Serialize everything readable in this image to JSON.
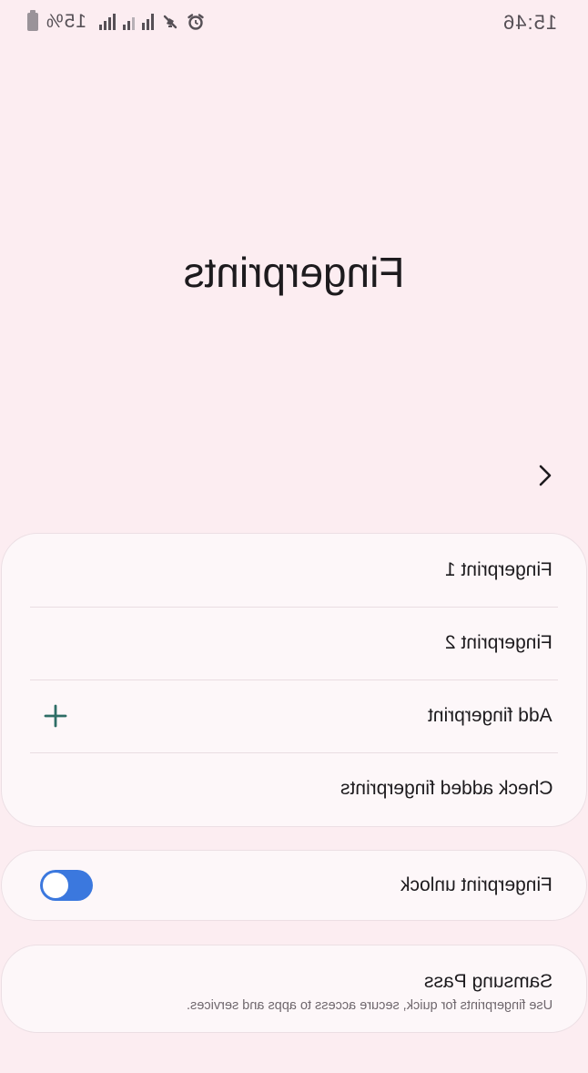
{
  "status_bar": {
    "battery_percent": "15%",
    "time": "15:46",
    "icons": [
      "battery-icon",
      "signal-icon",
      "signal-icon",
      "signal-icon",
      "mute-icon",
      "alarm-icon"
    ]
  },
  "page": {
    "title": "Fingerprints"
  },
  "fingerprint_list": {
    "items": [
      {
        "label": "Fingerprint 1"
      },
      {
        "label": "Fingerprint 2"
      }
    ],
    "add_label": "Add fingerprint",
    "check_label": "Check added fingerprints"
  },
  "unlock": {
    "label": "Fingerprint unlock",
    "enabled": true
  },
  "samsung_pass": {
    "title": "Samsung Pass",
    "subtitle": "Use fingerprints for quick, secure access to apps and services."
  },
  "colors": {
    "background": "#fcedf1",
    "card": "#fdf7f9",
    "accent": "#3b78de",
    "plus_icon": "#2e6d66"
  }
}
